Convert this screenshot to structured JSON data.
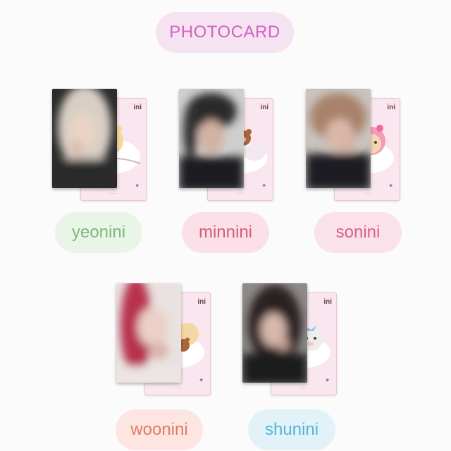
{
  "header": {
    "title": "PHOTOCARD"
  },
  "cards": [
    {
      "name": "yeonini",
      "name_color": "#7eb87c",
      "pill_color": "#e9f5e6",
      "back_title": "ini",
      "back_caption": "·····"
    },
    {
      "name": "minnini",
      "name_color": "#d65a7a",
      "pill_color": "#fbe1e7",
      "back_title": "ini",
      "back_caption": "·····"
    },
    {
      "name": "sonini",
      "name_color": "#d8608c",
      "pill_color": "#fbe1ea",
      "back_title": "ini",
      "back_caption": "·····"
    },
    {
      "name": "woonini",
      "name_color": "#e07a67",
      "pill_color": "#fde6e1",
      "back_title": "ini",
      "back_caption": "·····"
    },
    {
      "name": "shunini",
      "name_color": "#55b6d8",
      "pill_color": "#e2f2f8",
      "back_title": "ini",
      "back_caption": "·····"
    }
  ]
}
